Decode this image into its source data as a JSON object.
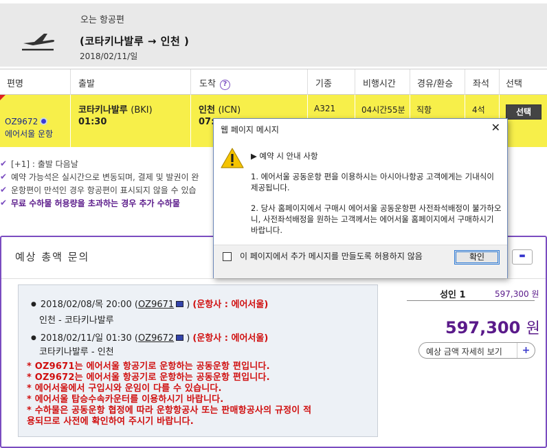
{
  "header": {
    "label": "오는 항공편",
    "route": "(코타키나발루 → 인천 )",
    "date": "2018/02/11/일"
  },
  "table": {
    "columns": [
      "편명",
      "출발",
      "도착",
      "기종",
      "비행시간",
      "경유/환승",
      "좌석",
      "선택"
    ],
    "row": {
      "flight": "OZ9672",
      "operator": "에어서울 운항",
      "dep_city": "코타키나발루",
      "dep_code": "(BKI)",
      "dep_time": "01:30",
      "arr_city": "인천",
      "arr_code": "(ICN)",
      "arr_time": "07:",
      "aircraft": "A321",
      "duration": "04시간55분",
      "stops": "직항",
      "seats": "4석",
      "select_label": "선택"
    }
  },
  "notes": [
    "[+1] : 출발 다음날",
    "예약 가능석은 실시간으로 변동되며, 결제 및 발권이 완",
    "운항편이 만석인 경우 항공편이 표시되지 않을 수 있습",
    "무료 수하물 허용량을 초과하는 경우 추가 수하물"
  ],
  "fare": {
    "title": "예상 총액 문의",
    "segments": [
      {
        "date": "2018/02/08/목 20:00",
        "flight": "OZ9671",
        "operator": "(운항사 : 에어서울)",
        "route": "인천 - 코타키나발루"
      },
      {
        "date": "2018/02/11/일 01:30",
        "flight": "OZ9672",
        "operator": "(운항사 : 에어서울)",
        "route": "코타키나발루 - 인천"
      }
    ],
    "warnings": [
      "* OZ9671는 에어서울 항공기로 운항하는 공동운항 편입니다.",
      "* OZ9672는 에어서울 항공기로 운항하는 공동운항 편입니다.",
      "* 에어서울에서 구입시와 운임이 다를 수 있습니다.",
      "* 에어서울 탑승수속카운터를 이용하시기 바랍니다.",
      "* 수하물은 공동운항 협정에 따라 운항항공사 또는 판매항공사의 규정이 적",
      "용되므로 사전에 확인하여 주시기 바랍니다."
    ],
    "adult_label": "성인 1",
    "adult_amount": "597,300 원",
    "total_amount": "597,300",
    "total_unit": "원",
    "detail_button": "예상 금액 자세히 보기",
    "detail_plus": "+"
  },
  "dialog": {
    "title": "웹 페이지 메시지",
    "close": "✕",
    "heading": "▶ 예약 시 안내 사항",
    "para1": "1. 에어서울 공동운항 편을 이용하시는 아시아나항공 고객에게는 기내식이 제공됩니다.",
    "para2": "2. 당사 홈페이지에서 구매시 에어서울 공동운항편 사전좌석배정이 불가하오니, 사전좌석배정을 원하는 고객께서는 에어서울 홈페이지에서 구매하시기 바랍니다.",
    "checkbox_label": "이 페이지에서 추가 메시지를 만들도록 허용하지 않음",
    "ok_label": "확인"
  },
  "colors": {
    "accent_purple": "#7a4cc0",
    "row_highlight": "#f7ef4a",
    "warning_red": "#d01010",
    "price_purple": "#5a1a8a"
  },
  "icons": [
    "plane-icon",
    "help-icon",
    "checkmark-icon",
    "document-icon",
    "warning-icon",
    "close-icon"
  ]
}
